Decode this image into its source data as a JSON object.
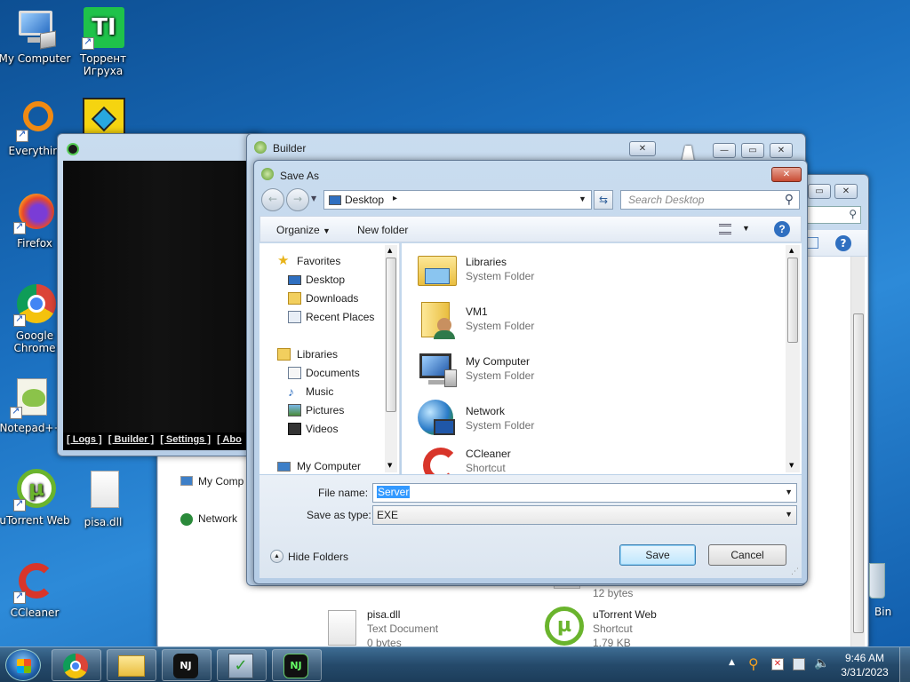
{
  "desktop": {
    "icons": [
      {
        "label": "My Computer"
      },
      {
        "label": "Торрент\nИгруха"
      },
      {
        "label": "Everything"
      },
      {
        "label": "Firefox"
      },
      {
        "label": "Google Chrome"
      },
      {
        "label": "Notepad++"
      },
      {
        "label": "uTorrent Web"
      },
      {
        "label": "pisa.dll"
      },
      {
        "label": "CCleaner"
      },
      {
        "label": "Recycle Bin"
      }
    ]
  },
  "nj_window": {
    "menu": [
      "[ Logs ]",
      "[ Builder ]",
      "[ Settings ]",
      "[ Abo"
    ]
  },
  "builder_window": {
    "title": "Builder"
  },
  "back_explorer": {
    "nav_items": [
      "My Comp",
      "Network"
    ],
    "files": [
      {
        "name": "pisa.dll",
        "type": "Text Document",
        "size": "0 bytes"
      },
      {
        "name": "uTorrent Web",
        "type": "Shortcut",
        "size": "1.79 KB"
      }
    ],
    "partial_size": "12 bytes",
    "recycle_label": "Bin"
  },
  "save_as": {
    "title": "Save As",
    "address": "Desktop",
    "search_placeholder": "Search Desktop",
    "organize": "Organize",
    "new_folder": "New folder",
    "nav": {
      "favorites": "Favorites",
      "desktop": "Desktop",
      "downloads": "Downloads",
      "recent": "Recent Places",
      "libraries": "Libraries",
      "documents": "Documents",
      "music": "Music",
      "pictures": "Pictures",
      "videos": "Videos",
      "computer": "My Computer"
    },
    "items": [
      {
        "name": "Libraries",
        "type": "System Folder"
      },
      {
        "name": "VM1",
        "type": "System Folder"
      },
      {
        "name": "My Computer",
        "type": "System Folder"
      },
      {
        "name": "Network",
        "type": "System Folder"
      },
      {
        "name": "CCleaner",
        "type": "Shortcut"
      }
    ],
    "file_name_label": "File name:",
    "file_name_value": "Server",
    "save_type_label": "Save as type:",
    "save_type_value": "EXE",
    "hide_folders": "Hide Folders",
    "save": "Save",
    "cancel": "Cancel"
  },
  "taskbar": {
    "time": "9:46 AM",
    "date": "3/31/2023"
  }
}
